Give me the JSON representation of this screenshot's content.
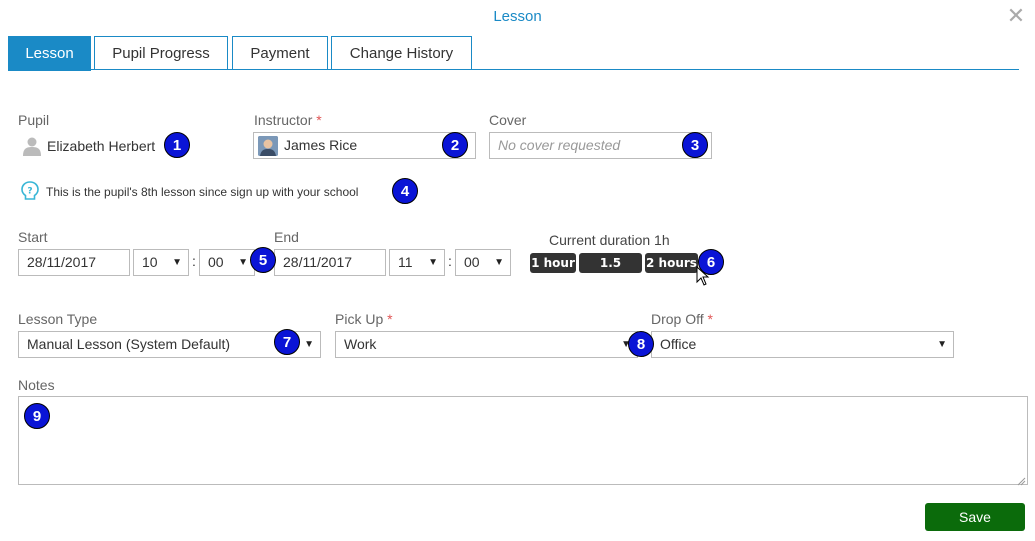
{
  "dialog": {
    "title": "Lesson"
  },
  "tabs": [
    {
      "label": "Lesson"
    },
    {
      "label": "Pupil Progress"
    },
    {
      "label": "Payment"
    },
    {
      "label": "Change History"
    }
  ],
  "pupil": {
    "label": "Pupil",
    "name": "Elizabeth Herbert"
  },
  "instructor": {
    "label": "Instructor",
    "required_mark": "*",
    "value": "James Rice"
  },
  "cover": {
    "label": "Cover",
    "placeholder": "No cover requested"
  },
  "info": {
    "text": "This is the pupil's 8th lesson since sign up with your school"
  },
  "start": {
    "label": "Start",
    "date": "28/11/2017",
    "hour": "10",
    "minute": "00"
  },
  "end": {
    "label": "End",
    "date": "28/11/2017",
    "hour": "11",
    "minute": "00"
  },
  "time_separator": ":",
  "duration": {
    "label": "Current duration 1h",
    "buttons": [
      "1 hour",
      "1.5 hours",
      "2 hours"
    ]
  },
  "lesson_type": {
    "label": "Lesson Type",
    "value": "Manual Lesson (System Default)"
  },
  "pick_up": {
    "label": "Pick Up",
    "required_mark": "*",
    "value": "Work"
  },
  "drop_off": {
    "label": "Drop Off",
    "required_mark": "*",
    "value": "Office"
  },
  "notes": {
    "label": "Notes",
    "value": ""
  },
  "save": {
    "label": "Save"
  },
  "annotations": [
    "1",
    "2",
    "3",
    "4",
    "5",
    "6",
    "7",
    "8",
    "9"
  ],
  "colors": {
    "accent": "#1a8ac6",
    "badge": "#0a14d6",
    "save": "#0b6b0b",
    "duration_button": "#333333",
    "required": "#e05555"
  },
  "icons": {
    "close": "close-icon",
    "pupil": "person-icon",
    "instructor": "instructor-avatar",
    "info": "lightbulb-question-icon",
    "select": "caret-down-icon"
  }
}
